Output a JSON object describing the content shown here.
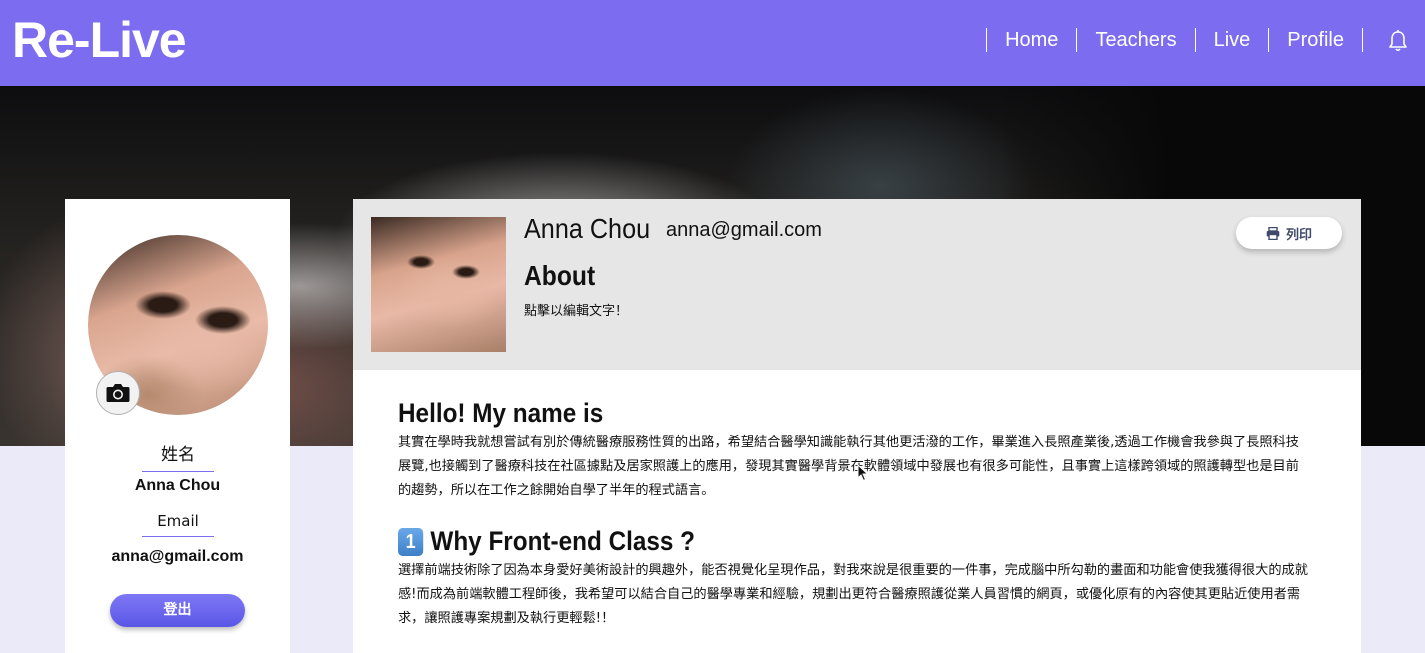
{
  "header": {
    "logo": "Re-Live",
    "nav": [
      {
        "label": "Home"
      },
      {
        "label": "Teachers"
      },
      {
        "label": "Live"
      },
      {
        "label": "Profile"
      }
    ]
  },
  "sidebar": {
    "name_label": "姓名",
    "name_value": "Anna Chou",
    "email_label": "Email",
    "email_value": "anna@gmail.com",
    "logout_label": "登出"
  },
  "profile": {
    "name": "Anna Chou",
    "email": "anna@gmail.com",
    "about_title": "About",
    "about_text": "點擊以編輯文字！",
    "print_label": "列印"
  },
  "content": {
    "section1_title": "Hello! My name is",
    "section1_text": "其實在學時我就想嘗試有別於傳統醫療服務性質的出路，希望結合醫學知識能執行其他更活潑的工作，畢業進入長照產業後,透過工作機會我參與了長照科技展覽,也接觸到了醫療科技在社區據點及居家照護上的應用，發現其實醫學背景在軟體領域中發展也有很多可能性，且事實上這樣跨領域的照護轉型也是目前的趨勢，所以在工作之餘開始自學了半年的程式語言。",
    "section2_badge": "1",
    "section2_title": "Why Front-end Class ?",
    "section2_text": "選擇前端技術除了因為本身愛好美術設計的興趣外，能否視覺化呈現作品，對我來說是很重要的一件事，完成腦中所勾勒的畫面和功能會使我獲得很大的成就感!而成為前端軟體工程師後，我希望可以結合自己的醫學專業和經驗，規劃出更符合醫療照護從業人員習慣的網頁，或優化原有的內容使其更貼近使用者需求，讓照護專案規劃及執行更輕鬆!！"
  },
  "colors": {
    "brand": "#7b6cf0",
    "button": "#5a57e6",
    "card_header": "#e6e6e6"
  }
}
